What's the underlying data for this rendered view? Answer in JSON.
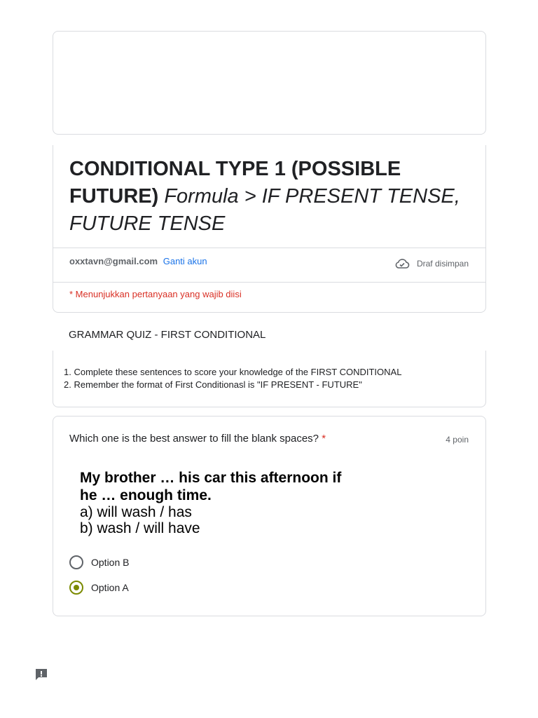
{
  "form": {
    "title_bold": "CONDITIONAL TYPE 1 (POSSIBLE FUTURE)",
    "title_italic": "Formula > IF PRESENT TENSE, FUTURE TENSE",
    "email": "oxxtavn@gmail.com",
    "switch_account": "Ganti akun",
    "draft_status": "Draf disimpan",
    "required_note": "* Menunjukkan pertanyaan yang wajib diisi"
  },
  "section": {
    "title": "GRAMMAR QUIZ - FIRST CONDITIONAL",
    "items": [
      "1. Complete these sentences to score your knowledge of the FIRST CONDITIONAL",
      "2. Remember the format of First Conditionasl is \"IF PRESENT - FUTURE\""
    ]
  },
  "question": {
    "text": "Which one is the best answer to fill the blank spaces?",
    "required_mark": "*",
    "points": "4 poin",
    "image_lines": [
      "My brother … his car this afternoon if",
      "he … enough time.",
      "a)  will wash / has",
      "b)  wash / will have"
    ],
    "options": [
      {
        "label": "Option B",
        "selected": false
      },
      {
        "label": "Option A",
        "selected": true
      }
    ]
  },
  "colors": {
    "accent": "#7b8a00",
    "link": "#1a73e8",
    "required": "#d93025"
  },
  "icons": [
    "cloud-check-icon",
    "feedback-icon"
  ]
}
